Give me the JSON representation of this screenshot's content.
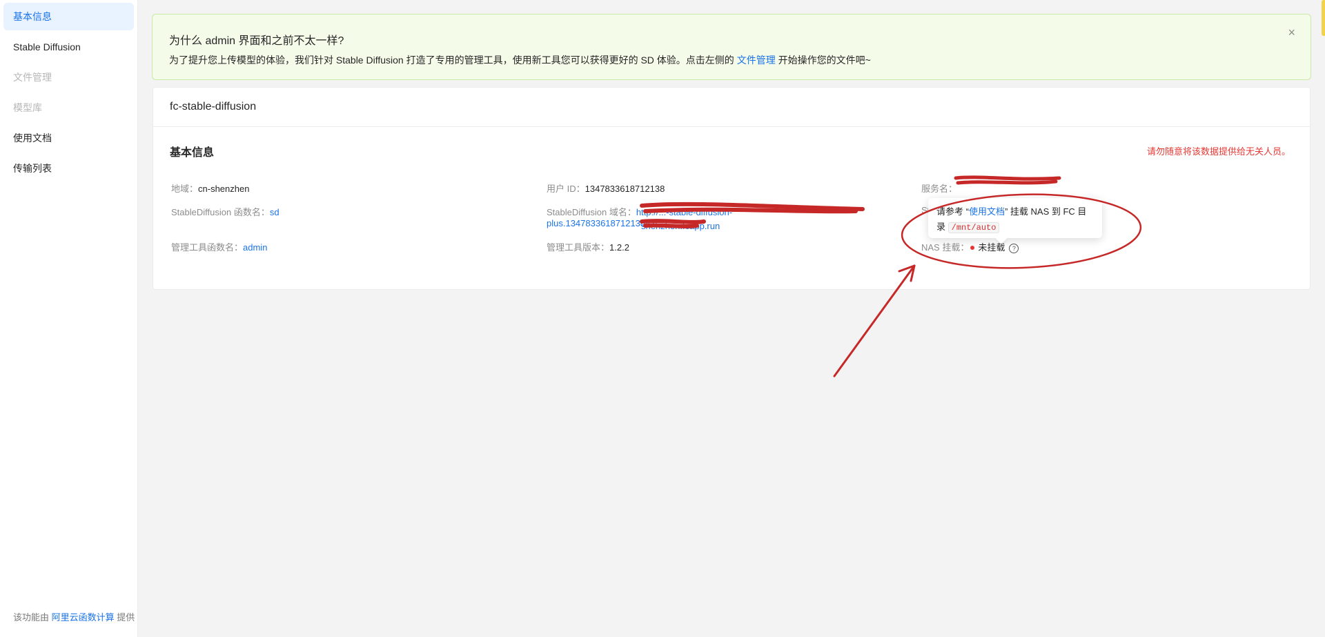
{
  "sidebar": {
    "items": [
      {
        "label": "基本信息",
        "state": "active"
      },
      {
        "label": "Stable Diffusion",
        "state": "normal"
      },
      {
        "label": "文件管理",
        "state": "disabled"
      },
      {
        "label": "模型库",
        "state": "disabled"
      },
      {
        "label": "使用文档",
        "state": "normal"
      },
      {
        "label": "传输列表",
        "state": "normal"
      }
    ],
    "footer": {
      "prefix": "该功能由 ",
      "link": "阿里云函数计算",
      "suffix": " 提供"
    }
  },
  "alert": {
    "title": "为什么 admin 界面和之前不太一样?",
    "desc_before": "为了提升您上传模型的体验，我们针对 Stable Diffusion 打造了专用的管理工具，使用新工具您可以获得更好的 SD 体验。点击左侧的 ",
    "desc_link": "文件管理",
    "desc_after": " 开始操作您的文件吧~",
    "close_icon": "×"
  },
  "card": {
    "header": "fc-stable-diffusion",
    "section_title": "基本信息",
    "warning": "请勿随意将该数据提供给无关人员。",
    "fields": {
      "region": {
        "label": "地域：",
        "value": "cn-shenzhen"
      },
      "user_id": {
        "label": "用户 ID：",
        "value": "1347833618712138"
      },
      "service": {
        "label": "服务名：",
        "value": ""
      },
      "sd_func": {
        "label": "StableDiffusion 函数名：",
        "value": "sd"
      },
      "sd_domain": {
        "label": "StableDiffusion 域名：",
        "value_line1": "http://...-stable-diffusion-plus.1347833618712138.cn-",
        "value_line2": "shenzhen.fcapp.run"
      },
      "admin_func": {
        "label": "管理工具函数名：",
        "value": "admin"
      },
      "admin_version": {
        "label": "管理工具版本：",
        "value": "1.2.2"
      },
      "nas": {
        "label": "NAS 挂载：",
        "value": "未挂载",
        "help_icon": "?"
      }
    },
    "obscured_label": "St"
  },
  "tooltip": {
    "text_before": "请参考 “",
    "link": "使用文档",
    "text_after": "” 挂载 NAS 到 FC 目录 ",
    "code": "/mnt/auto"
  },
  "colors": {
    "accent": "#1a73e8",
    "warning": "#e53935",
    "annotation": "#c62828",
    "alert_bg": "#f4fbe9"
  }
}
